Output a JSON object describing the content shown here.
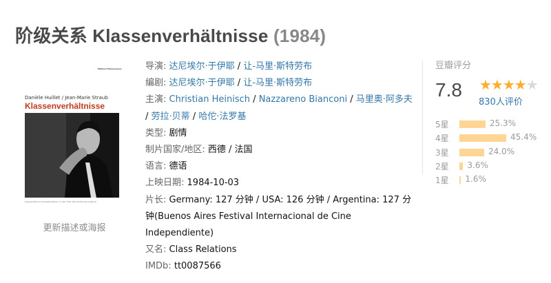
{
  "title": {
    "name": "阶级关系 Klassenverhältnisse",
    "year": "(1984)"
  },
  "poster": {
    "brand": "Edition Filmmuseum",
    "names": "Danièle Huillet / Jean-Marie Straub",
    "title": "Klassenverhältnisse",
    "fine_print": "Doppel-DVD mit Zusatzmaterial / 2-disc DVD with additional material"
  },
  "update_link": "更新描述或海报",
  "info": {
    "director_label": "导演:",
    "directors": [
      "达尼埃尔·于伊耶",
      "让-马里·斯特劳布"
    ],
    "writer_label": "编剧:",
    "writers": [
      "达尼埃尔·于伊耶",
      "让-马里·斯特劳布"
    ],
    "cast_label": "主演:",
    "cast": [
      "Christian Heinisch",
      "Nazzareno Bianconi",
      "马里奥·阿多夫",
      "劳拉·贝蒂",
      "哈佗·法罗基"
    ],
    "genre_label": "类型:",
    "genre": "剧情",
    "country_label": "制片国家/地区:",
    "country": "西德 / 法国",
    "language_label": "语言:",
    "language": "德语",
    "release_label": "上映日期:",
    "release": "1984-10-03",
    "runtime_label": "片长:",
    "runtime": "Germany: 127 分钟 / USA: 126 分钟 / Argentina: 127 分钟(Buenos Aires Festival Internacional de Cine Independiente)",
    "aka_label": "又名:",
    "aka": "Class Relations",
    "imdb_label": "IMDb:",
    "imdb": "tt0087566",
    "separator": " / "
  },
  "rating": {
    "label": "豆瓣评分",
    "score": "7.8",
    "stars": "★★★★",
    "stars_empty": "★",
    "count": "830人评价",
    "star_color": "#ffac2d",
    "bar_color": "#ffd596",
    "link_color": "#3377aa",
    "distribution": [
      {
        "label": "5星",
        "pct": "25.3%",
        "value": 25.3
      },
      {
        "label": "4星",
        "pct": "45.4%",
        "value": 45.4
      },
      {
        "label": "3星",
        "pct": "24.0%",
        "value": 24.0
      },
      {
        "label": "2星",
        "pct": "3.6%",
        "value": 3.6
      },
      {
        "label": "1星",
        "pct": "1.6%",
        "value": 1.6
      }
    ]
  }
}
